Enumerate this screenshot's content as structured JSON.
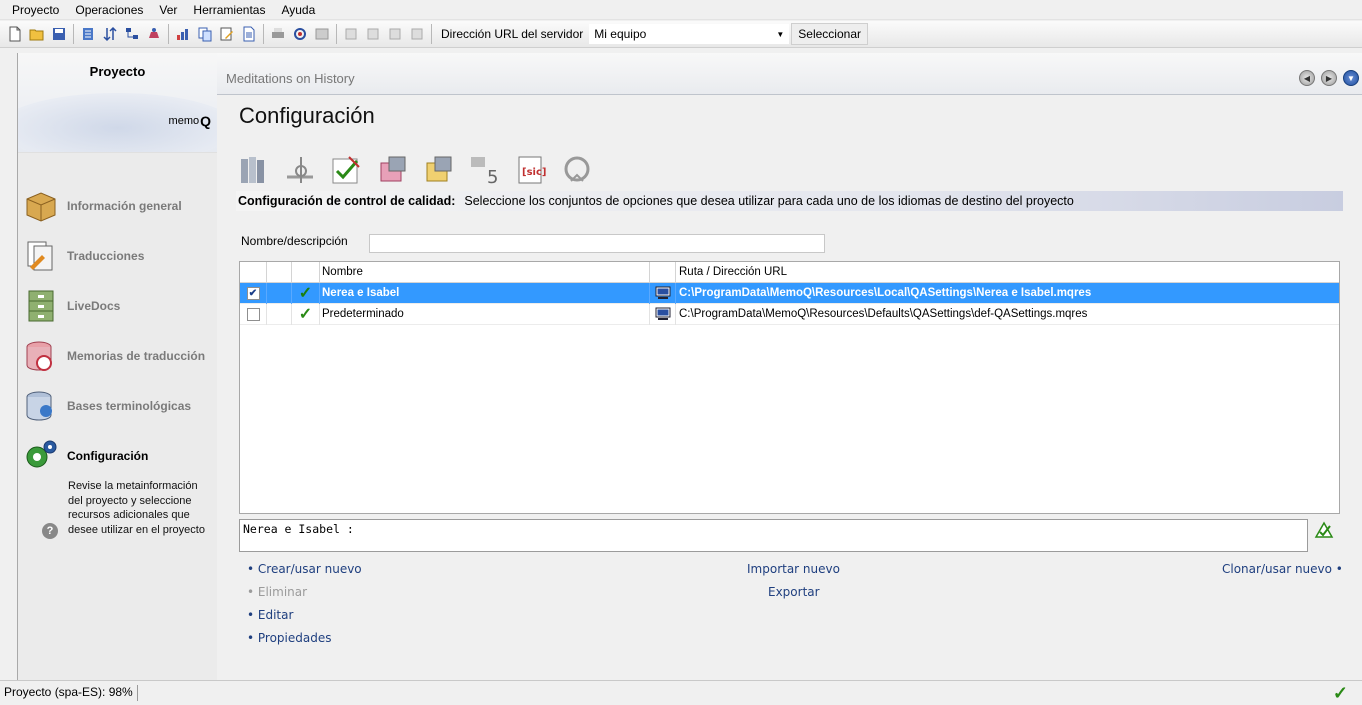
{
  "menubar": {
    "items": [
      "Proyecto",
      "Operaciones",
      "Ver",
      "Herramientas",
      "Ayuda"
    ]
  },
  "toolbar": {
    "server_label": "Dirección URL del servidor",
    "server_value": "Mi equipo",
    "select_button": "Seleccionar"
  },
  "sidebar": {
    "title": "Proyecto",
    "logo_text": "memo",
    "logo_q": "Q",
    "items": [
      {
        "label": "Información general",
        "icon": "box-icon",
        "active": false
      },
      {
        "label": "Traducciones",
        "icon": "documents-icon",
        "active": false
      },
      {
        "label": "LiveDocs",
        "icon": "cabinet-icon",
        "active": false
      },
      {
        "label": "Memorias de traducción",
        "icon": "database-icon",
        "active": false
      },
      {
        "label": "Bases terminológicas",
        "icon": "termbase-icon",
        "active": false
      },
      {
        "label": "Configuración",
        "icon": "gears-icon",
        "active": true
      }
    ],
    "description": "Revise la metainformación del proyecto y seleccione recursos adicionales que desee utilizar en el proyecto",
    "help": "?"
  },
  "main": {
    "breadcrumb": "Meditations on History",
    "title": "Configuración",
    "section_label": "Configuración de control de calidad:",
    "section_desc": "Seleccione los conjuntos de opciones que desea utilizar para cada uno de los idiomas de destino del proyecto",
    "filter_label": "Nombre/descripción",
    "filter_value": ""
  },
  "table": {
    "columns": [
      "",
      "",
      "",
      "Nombre",
      "",
      "Ruta / Dirección URL"
    ],
    "rows": [
      {
        "checked": true,
        "name": "Nerea e Isabel",
        "path": "C:\\ProgramData\\MemoQ\\Resources\\Local\\QASettings\\Nerea e Isabel.mqres",
        "selected": true
      },
      {
        "checked": false,
        "name": "Predeterminado",
        "path": "C:\\ProgramData\\MemoQ\\Resources\\Defaults\\QASettings\\def-QASettings.mqres",
        "selected": false
      }
    ]
  },
  "comment": "Nerea e Isabel :",
  "actions": {
    "create": "• Crear/usar nuevo",
    "delete": "• Eliminar",
    "edit": "• Editar",
    "properties": "• Propiedades",
    "import": "Importar nuevo",
    "export": "Exportar",
    "clone": "Clonar/usar nuevo •"
  },
  "status": {
    "text": "Proyecto (spa-ES): 98%"
  },
  "colors": {
    "selection": "#3399ff",
    "link": "#1f3f7f",
    "check": "#2a8a16"
  }
}
